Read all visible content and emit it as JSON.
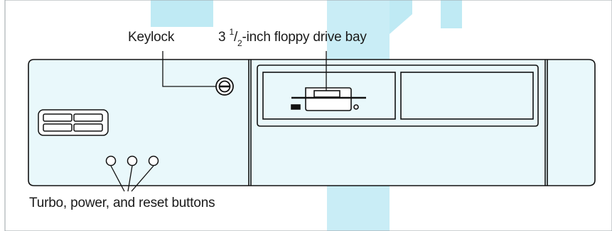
{
  "labels": {
    "keylock": "Keylock",
    "floppy_prefix": "3 ",
    "floppy_num": "1",
    "floppy_slash": "/",
    "floppy_den": "2",
    "floppy_suffix": "-inch floppy drive bay",
    "buttons": "Turbo, power, and reset buttons"
  },
  "colors": {
    "outline": "#111111",
    "panel_fill": "#e9f8fb",
    "watermark": "#bfeaf4",
    "label_text": "#1a1a1a"
  }
}
